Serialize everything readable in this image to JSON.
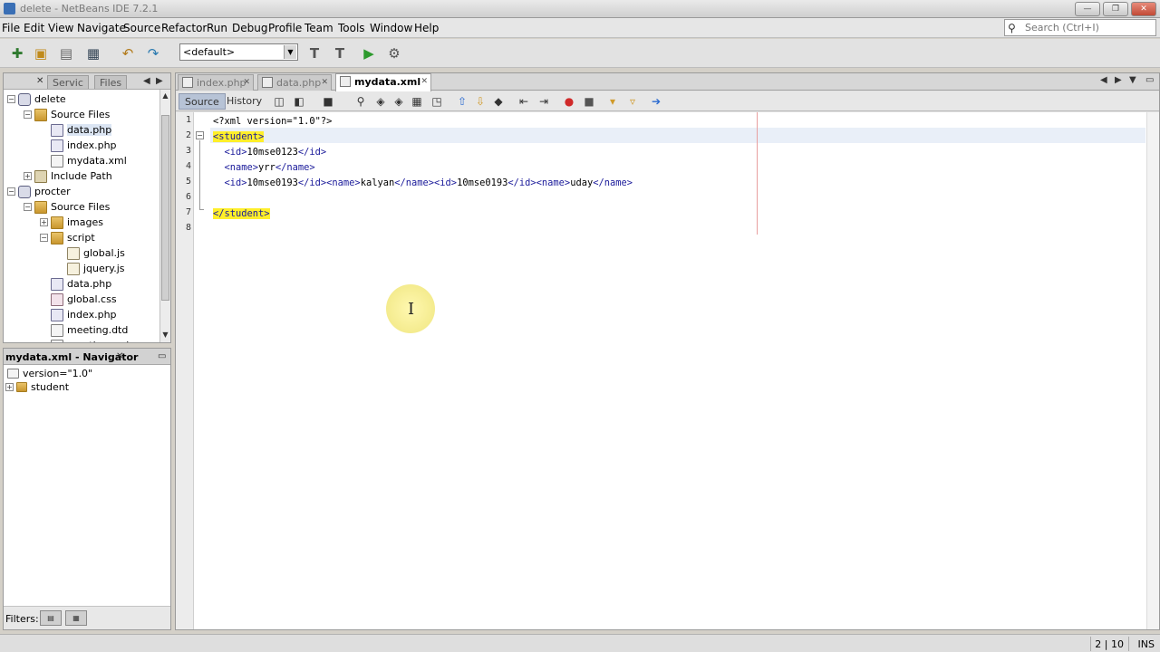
{
  "window": {
    "title": "delete - NetBeans IDE 7.2.1",
    "buttons": [
      "—",
      "❐",
      "✕"
    ]
  },
  "menu": [
    "File",
    "Edit",
    "View",
    "Navigate",
    "Source",
    "Refactor",
    "Run",
    "Debug",
    "Profile",
    "Team",
    "Tools",
    "Window",
    "Help"
  ],
  "search": {
    "placeholder": "Search (Ctrl+I)"
  },
  "toolbar": {
    "config_value": "<default>"
  },
  "projects_panel": {
    "tabs": [
      "Servic",
      "Files"
    ],
    "tree": [
      {
        "label": "delete",
        "indent": 0,
        "icon": "proj",
        "expander": "−"
      },
      {
        "label": "Source Files",
        "indent": 1,
        "icon": "folder",
        "expander": "−"
      },
      {
        "label": "data.php",
        "indent": 2,
        "icon": "php",
        "selected": true
      },
      {
        "label": "index.php",
        "indent": 2,
        "icon": "php"
      },
      {
        "label": "mydata.xml",
        "indent": 2,
        "icon": "file"
      },
      {
        "label": "Include Path",
        "indent": 1,
        "icon": "path",
        "expander": "+"
      },
      {
        "label": "procter",
        "indent": 0,
        "icon": "proj",
        "expander": "−"
      },
      {
        "label": "Source Files",
        "indent": 1,
        "icon": "folder",
        "expander": "−"
      },
      {
        "label": "images",
        "indent": 2,
        "icon": "folder",
        "expander": "+"
      },
      {
        "label": "script",
        "indent": 2,
        "icon": "folder",
        "expander": "−"
      },
      {
        "label": "global.js",
        "indent": 3,
        "icon": "js"
      },
      {
        "label": "jquery.js",
        "indent": 3,
        "icon": "js"
      },
      {
        "label": "data.php",
        "indent": 2,
        "icon": "php"
      },
      {
        "label": "global.css",
        "indent": 2,
        "icon": "css"
      },
      {
        "label": "index.php",
        "indent": 2,
        "icon": "php"
      },
      {
        "label": "meeting.dtd",
        "indent": 2,
        "icon": "file"
      },
      {
        "label": "meeting.xsd",
        "indent": 2,
        "icon": "file"
      }
    ]
  },
  "navigator": {
    "title": "mydata.xml - Navigator",
    "items": [
      {
        "label": "version=\"1.0\"",
        "expander": ""
      },
      {
        "label": "student",
        "expander": "+"
      }
    ],
    "filters_label": "Filters:"
  },
  "editor": {
    "tabs": [
      {
        "label": "index.php",
        "active": false
      },
      {
        "label": "data.php",
        "active": false
      },
      {
        "label": "mydata.xml",
        "active": true
      }
    ],
    "view_tabs": [
      "Source",
      "History"
    ],
    "line_numbers": [
      "1",
      "2",
      "3",
      "4",
      "5",
      "6",
      "7",
      "8"
    ],
    "lines": [
      [
        {
          "t": "<?xml version=\"1.0\"?>",
          "c": "pi"
        }
      ],
      [
        {
          "t": "<student>",
          "c": "match"
        }
      ],
      [
        {
          "t": "  <id>",
          "c": "tag"
        },
        {
          "t": "10mse0123",
          "c": "txt"
        },
        {
          "t": "</id>",
          "c": "tag"
        }
      ],
      [
        {
          "t": "  <name>",
          "c": "tag"
        },
        {
          "t": "yrr",
          "c": "txt"
        },
        {
          "t": "</name>",
          "c": "tag"
        }
      ],
      [
        {
          "t": "  <id>",
          "c": "tag"
        },
        {
          "t": "10mse0193",
          "c": "txt"
        },
        {
          "t": "</id><name>",
          "c": "tag"
        },
        {
          "t": "kalyan",
          "c": "txt"
        },
        {
          "t": "</name><id>",
          "c": "tag"
        },
        {
          "t": "10mse0193",
          "c": "txt"
        },
        {
          "t": "</id><name>",
          "c": "tag"
        },
        {
          "t": "uday",
          "c": "txt"
        },
        {
          "t": "</name>",
          "c": "tag"
        }
      ],
      [],
      [
        {
          "t": "</student>",
          "c": "match"
        }
      ],
      []
    ]
  },
  "status": {
    "position": "2 | 10",
    "mode": "INS"
  }
}
